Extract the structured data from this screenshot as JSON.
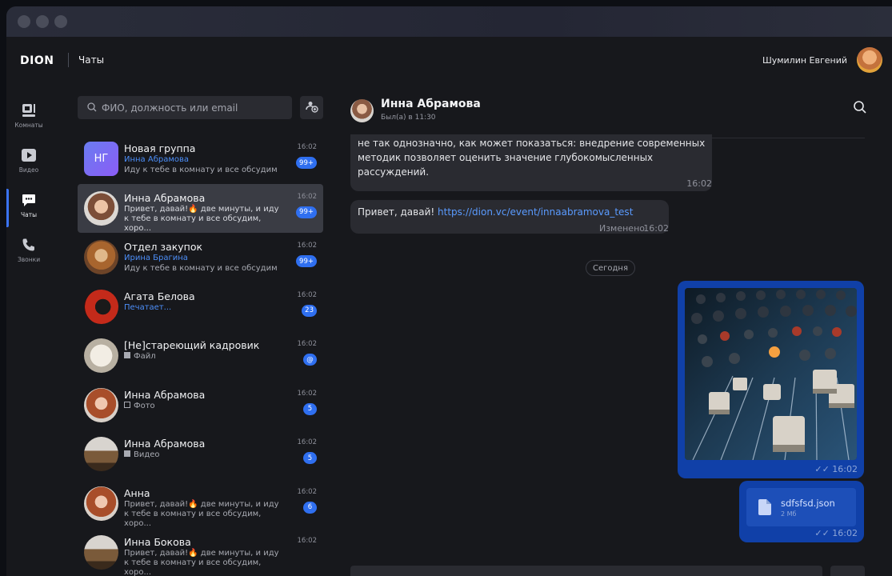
{
  "app": {
    "logo": "DION",
    "section_title": "Чаты"
  },
  "user": {
    "name": "Шумилин Евгений"
  },
  "nav": [
    {
      "label": "Комнаты",
      "icon": "rooms-icon"
    },
    {
      "label": "Видео",
      "icon": "video-icon"
    },
    {
      "label": "Чаты",
      "icon": "chat-icon",
      "active": true
    },
    {
      "label": "Звонки",
      "icon": "phone-icon"
    }
  ],
  "search": {
    "placeholder": "ФИО, должность или email"
  },
  "chats": [
    {
      "name": "Новая группа",
      "initials": "НГ",
      "time": "16:02",
      "author": "Инна Абрамова",
      "preview": "Иду к тебе в комнату и все обсудим",
      "badge": "99+"
    },
    {
      "name": "Инна Абрамова",
      "time": "16:02",
      "preview": "Привет, давай!🔥 две минуты, и иду\nк тебе в комнату и все обсудим, хоро...",
      "badge": "99+"
    },
    {
      "name": "Отдел закупок",
      "time": "16:02",
      "author": "Ирина Брагина",
      "preview": "Иду к тебе в комнату и все обсудим",
      "badge": "99+"
    },
    {
      "name": "Агата Белова",
      "time": "16:02",
      "typing": "Печатает...",
      "badge": "23"
    },
    {
      "name": "[Не]стареющий кадровик",
      "time": "16:02",
      "preview": "Файл",
      "badge": "@"
    },
    {
      "name": "Инна Абрамова",
      "time": "16:02",
      "preview": "Фото",
      "badge": "5"
    },
    {
      "name": "Инна Абрамова",
      "time": "16:02",
      "preview": "Видео",
      "badge": "5"
    },
    {
      "name": "Анна",
      "time": "16:02",
      "preview": "Привет, давай!🔥 две минуты, и иду\nк тебе в комнату и все обсудим, хоро...",
      "badge": "6"
    },
    {
      "name": "Инна Бокова",
      "time": "16:02",
      "preview": "Привет, давай!🔥 две минуты, и иду\nк тебе в комнату и все обсудим, хоро..."
    }
  ],
  "conversation": {
    "name": "Инна Абрамова",
    "status": "Был(а) в 11:30",
    "messages": {
      "m1_text": "не так однозначно, как может показаться: внедрение современных\nметодик позволяет оценить значение глубокомысленных\nрассуждений.",
      "m1_time": "16:02",
      "m2_text": "Привет, давай! ",
      "m2_link": "https://dion.vc/event/innaabramova_test",
      "m2_edited": "Изменено",
      "m2_time": "16:02",
      "date_sep": "Сегодня",
      "m3_time": "16:02",
      "m4_file_name": "sdfsfsd.json",
      "m4_file_size": "2 Мб",
      "m4_time": "16:02"
    }
  },
  "colors": {
    "accent": "#2f6ff0",
    "outgoing": "#1040a8",
    "bg": "#17181c"
  }
}
